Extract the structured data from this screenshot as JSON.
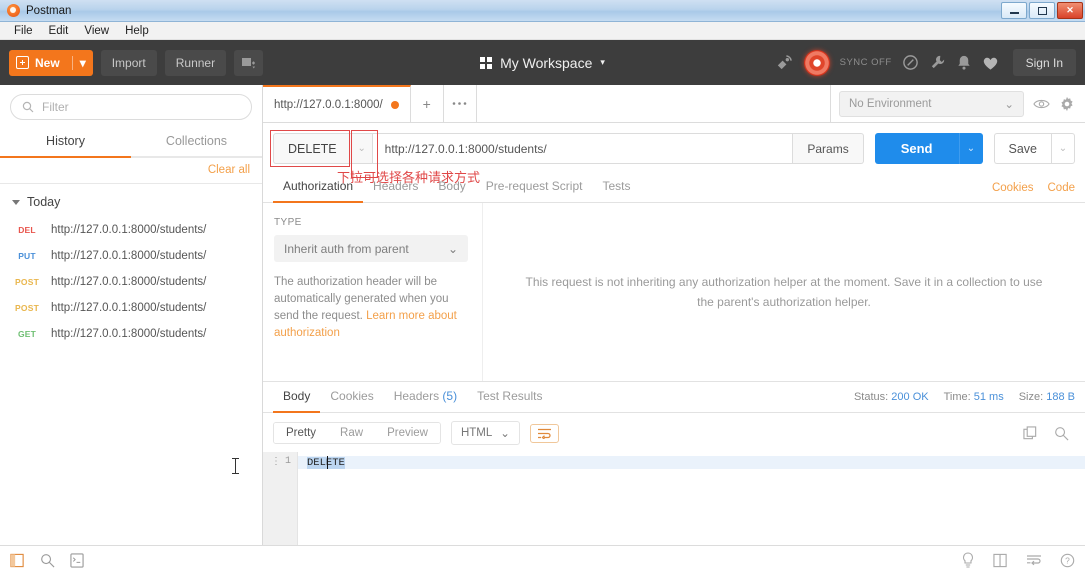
{
  "window": {
    "title": "Postman",
    "minimize_label": "minimize",
    "maximize_label": "maximize",
    "close_label": "✕"
  },
  "menubar": {
    "items": [
      "File",
      "Edit",
      "View",
      "Help"
    ]
  },
  "header": {
    "new_label": "New",
    "import_label": "Import",
    "runner_label": "Runner",
    "workspace_label": "My Workspace",
    "workspace_caret": "▾",
    "sync_label": "SYNC OFF",
    "signin_label": "Sign In",
    "accent_orange": "#f3761c",
    "bg": "#3d3d3d"
  },
  "sidebar": {
    "filter_placeholder": "Filter",
    "tabs": [
      {
        "label": "History",
        "active": true
      },
      {
        "label": "Collections",
        "active": false
      }
    ],
    "clear_all_label": "Clear all",
    "group_label": "Today",
    "history": [
      {
        "method": "DEL",
        "color": "#e8554d",
        "url": "http://127.0.0.1:8000/students/"
      },
      {
        "method": "PUT",
        "color": "#4a90d9",
        "url": "http://127.0.0.1:8000/students/"
      },
      {
        "method": "POST",
        "color": "#e9b64d",
        "url": "http://127.0.0.1:8000/students/"
      },
      {
        "method": "POST",
        "color": "#e9b64d",
        "url": "http://127.0.0.1:8000/students/"
      },
      {
        "method": "GET",
        "color": "#6fbf73",
        "url": "http://127.0.0.1:8000/students/"
      }
    ]
  },
  "tabstrip": {
    "request_tab_label": "http://127.0.0.1:8000/",
    "add_tab_label": "+",
    "more_tabs_label": "•••",
    "environment_value": "No Environment",
    "environment_caret": "⌄"
  },
  "request": {
    "method": "DELETE",
    "method_caret": "⌄",
    "url": "http://127.0.0.1:8000/students/",
    "params_label": "Params",
    "send_label": "Send",
    "send_caret": "⌄",
    "save_label": "Save",
    "save_caret": "⌄",
    "annotation_text": "下拉可选择各种请求方式",
    "annotation_color": "#e04848",
    "tabs": [
      {
        "label": "Authorization",
        "active": true
      },
      {
        "label": "Headers",
        "active": false
      },
      {
        "label": "Body",
        "active": false
      },
      {
        "label": "Pre-request Script",
        "active": false
      },
      {
        "label": "Tests",
        "active": false
      }
    ],
    "cookies_label": "Cookies",
    "code_label": "Code"
  },
  "auth": {
    "type_label": "TYPE",
    "type_value": "Inherit auth from parent",
    "type_caret": "⌄",
    "description_part1": "The authorization header will be automatically generated when you send the request. ",
    "description_link": "Learn more about authorization",
    "inherit_message": "This request is not inheriting any authorization helper at the moment. Save it in a collection to use the parent's authorization helper."
  },
  "response": {
    "tabs": [
      {
        "label": "Body",
        "count": "",
        "active": true
      },
      {
        "label": "Cookies",
        "count": "",
        "active": false
      },
      {
        "label": "Headers",
        "count": "(5)",
        "active": false
      },
      {
        "label": "Test Results",
        "count": "",
        "active": false
      }
    ],
    "status_label": "Status:",
    "status_value": "200 OK",
    "time_label": "Time:",
    "time_value": "51 ms",
    "size_label": "Size:",
    "size_value": "188 B",
    "view_modes": [
      {
        "label": "Pretty",
        "active": true
      },
      {
        "label": "Raw",
        "active": false
      },
      {
        "label": "Preview",
        "active": false
      }
    ],
    "format_value": "HTML",
    "format_caret": "⌄",
    "line_number": "1",
    "body_text": "DELETE"
  },
  "statusbar": {
    "left_icons": [
      "sidebar-toggle-icon",
      "search-icon",
      "console-icon"
    ],
    "right_icons": [
      "bulb-icon",
      "two-pane-icon",
      "wrap-lines-icon",
      "help-icon"
    ]
  }
}
